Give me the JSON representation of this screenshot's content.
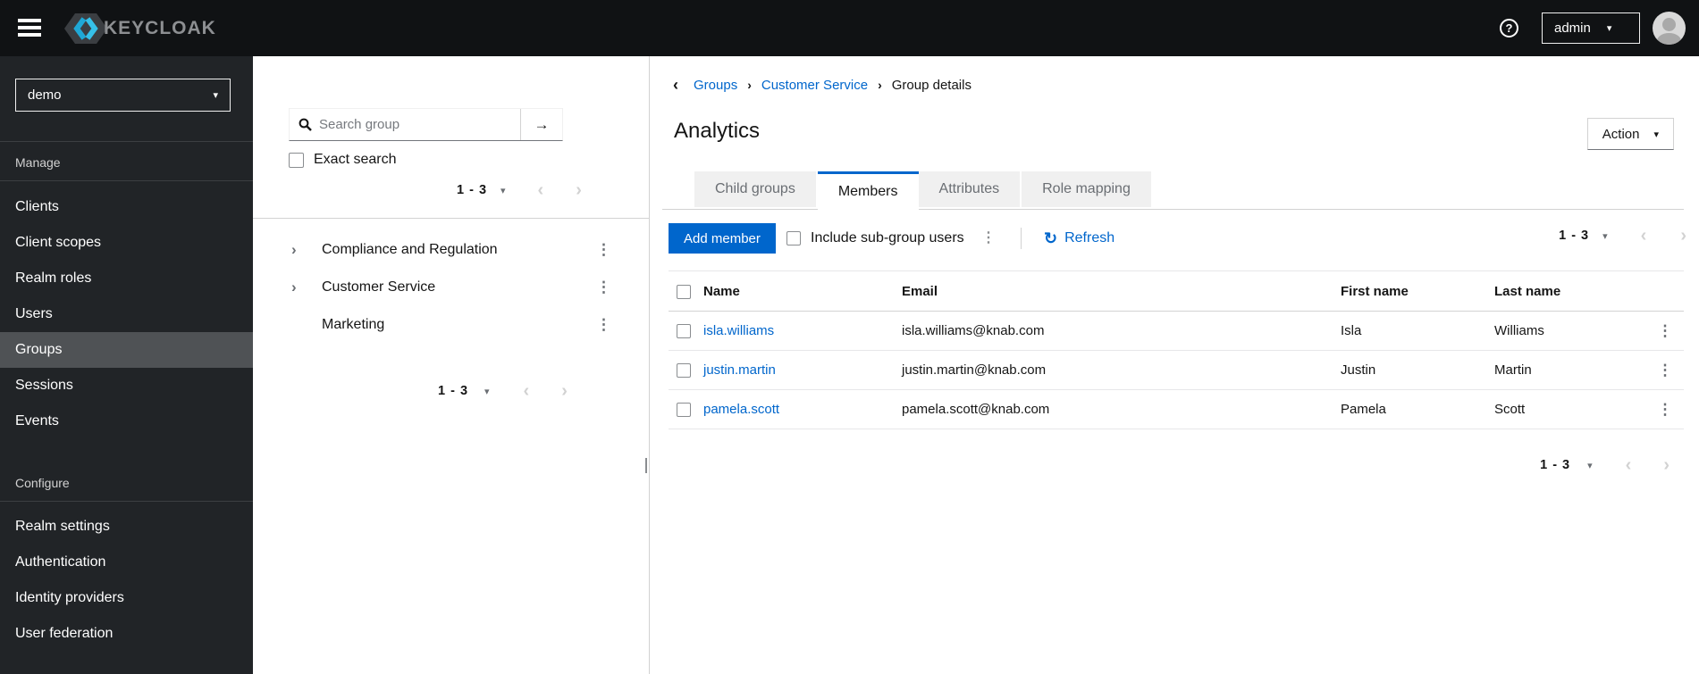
{
  "topbar": {
    "brand": "KEYCLOAK",
    "user_menu_label": "admin"
  },
  "sidebar": {
    "realm": "demo",
    "manage_label": "Manage",
    "manage_items": [
      "Clients",
      "Client scopes",
      "Realm roles",
      "Users",
      "Groups",
      "Sessions",
      "Events"
    ],
    "selected_item": "Groups",
    "configure_label": "Configure",
    "configure_items": [
      "Realm settings",
      "Authentication",
      "Identity providers",
      "User federation"
    ]
  },
  "groups_panel": {
    "search_placeholder": "Search group",
    "exact_search_label": "Exact search",
    "pagination_top": "1 - 3",
    "pagination_bottom": "1 - 3",
    "tree": [
      {
        "label": "Compliance and Regulation",
        "expandable": true
      },
      {
        "label": "Customer Service",
        "expandable": true
      },
      {
        "label": "Marketing",
        "expandable": false
      }
    ]
  },
  "main": {
    "breadcrumb": [
      "Groups",
      "Customer Service",
      "Group details"
    ],
    "title": "Analytics",
    "action_button_label": "Action",
    "tabs": [
      {
        "label": "Child groups",
        "active": false
      },
      {
        "label": "Members",
        "active": true
      },
      {
        "label": "Attributes",
        "active": false
      },
      {
        "label": "Role mapping",
        "active": false
      }
    ],
    "toolbar": {
      "add_member_label": "Add member",
      "include_subgroups_label": "Include sub-group users",
      "refresh_label": "Refresh",
      "pagination": "1 - 3"
    },
    "table": {
      "headers": [
        "Name",
        "Email",
        "First name",
        "Last name"
      ],
      "rows": [
        {
          "name": "isla.williams",
          "email": "isla.williams@knab.com",
          "first": "Isla",
          "last": "Williams"
        },
        {
          "name": "justin.martin",
          "email": "justin.martin@knab.com",
          "first": "Justin",
          "last": "Martin"
        },
        {
          "name": "pamela.scott",
          "email": "pamela.scott@knab.com",
          "first": "Pamela",
          "last": "Scott"
        }
      ]
    },
    "pagination_bottom": "1 - 3"
  },
  "icons": {
    "caret_down": "▾",
    "chevron_left": "‹",
    "chevron_right": "›",
    "angle_right": "›",
    "back": "‹",
    "breadcrumb_sep": "›",
    "kebab": "⋮",
    "arrow_right": "→",
    "refresh": "↻",
    "question": "?"
  },
  "colors": {
    "accent": "#0066cc",
    "topbar_bg": "#101214",
    "sidebar_bg": "#212427",
    "sidebar_selected_bg": "#4f5255",
    "link": "#0066cc",
    "tab_inactive_bg": "#f0f0f0"
  }
}
